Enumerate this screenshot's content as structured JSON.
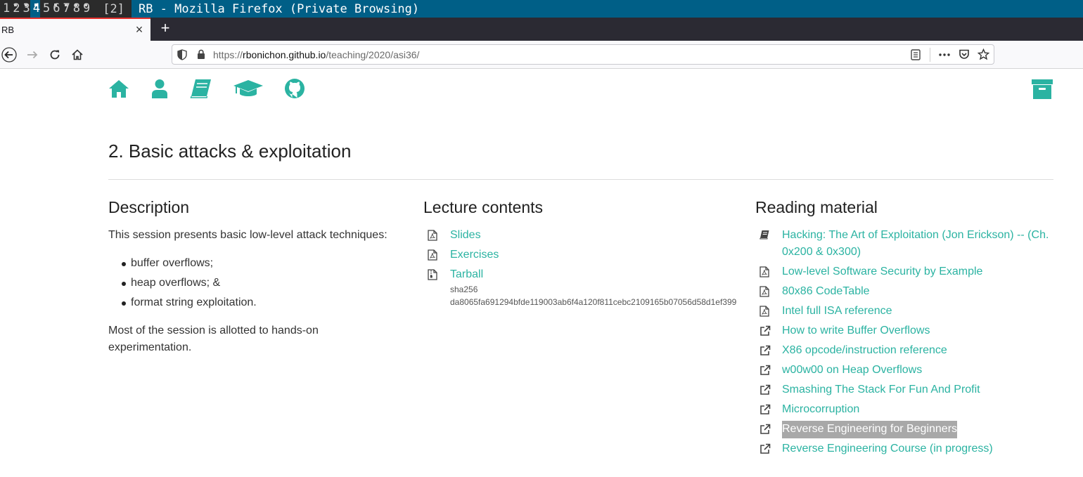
{
  "wm": {
    "workspaces": [
      {
        "label": "1",
        "marked": false,
        "active": false
      },
      {
        "label": "2",
        "marked": true,
        "active": false
      },
      {
        "label": "3",
        "marked": true,
        "active": false
      },
      {
        "label": "4",
        "marked": true,
        "active": true
      },
      {
        "label": "5",
        "marked": false,
        "active": false
      },
      {
        "label": "6",
        "marked": true,
        "active": false
      },
      {
        "label": "7",
        "marked": true,
        "active": false
      },
      {
        "label": "8",
        "marked": true,
        "active": false
      },
      {
        "label": "9",
        "marked": true,
        "active": false
      }
    ],
    "count": "[2]",
    "title": "RB - Mozilla Firefox (Private Browsing)"
  },
  "browser": {
    "tab_title": "RB",
    "tab_close": "×",
    "new_tab": "+",
    "url_scheme": "https://",
    "url_host": "rbonichon.github.io",
    "url_path": "/teaching/2020/asi36/"
  },
  "page": {
    "title": "2. Basic attacks & exploitation",
    "description": {
      "heading": "Description",
      "intro": "This session presents basic low-level attack techniques:",
      "bullets": [
        "buffer overflows;",
        "heap overflows; &",
        "format string exploitation."
      ],
      "outro": "Most of the session is allotted to hands-on experimentation."
    },
    "lecture": {
      "heading": "Lecture contents",
      "items": [
        {
          "label": "Slides",
          "icon": "pdf-file-icon"
        },
        {
          "label": "Exercises",
          "icon": "pdf-file-icon"
        },
        {
          "label": "Tarball",
          "icon": "archive-file-icon"
        }
      ],
      "hash_label": "sha256",
      "hash_value": "da8065fa691294bfde119003ab6f4a120f811cebc2109165b07056d58d1ef399"
    },
    "reading": {
      "heading": "Reading material",
      "items": [
        {
          "label": "Hacking: The Art of Exploitation (Jon Erickson) -- (Ch. 0x200 & 0x300)",
          "icon": "book-icon"
        },
        {
          "label": "Low-level Software Security by Example",
          "icon": "pdf-file-icon"
        },
        {
          "label": "80x86 CodeTable",
          "icon": "pdf-file-icon"
        },
        {
          "label": "Intel full ISA reference",
          "icon": "pdf-file-icon"
        },
        {
          "label": "How to write Buffer Overflows",
          "icon": "external-link-icon"
        },
        {
          "label": "X86 opcode/instruction reference",
          "icon": "external-link-icon"
        },
        {
          "label": "w00w00 on Heap Overflows",
          "icon": "external-link-icon"
        },
        {
          "label": "Smashing The Stack For Fun And Profit",
          "icon": "external-link-icon"
        },
        {
          "label": "Microcorruption",
          "icon": "external-link-icon"
        },
        {
          "label": "Reverse Engineering for Beginners",
          "icon": "external-link-icon",
          "selected": true
        },
        {
          "label": "Reverse Engineering Course (in progress)",
          "icon": "external-link-icon"
        }
      ]
    }
  },
  "colors": {
    "accent": "#2bb3a2",
    "wm_bar": "#005f87",
    "tab_indicator": "#e5302c"
  }
}
